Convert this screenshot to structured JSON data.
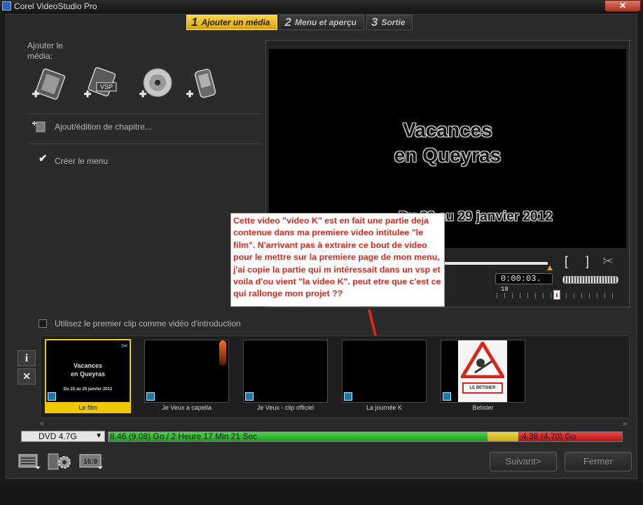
{
  "window": {
    "title": "Corel VideoStudio Pro",
    "close_label": "✕"
  },
  "steps": [
    {
      "num": "1",
      "label": "Ajouter un média"
    },
    {
      "num": "2",
      "label": "Menu et aperçu"
    },
    {
      "num": "3",
      "label": "Sortie"
    }
  ],
  "left_panel": {
    "add_media_label": "Ajouter le média:",
    "vsp_label": "VSP",
    "chapter_label": "Ajout/édition de chapitre...",
    "create_menu_label": "Créer le menu",
    "create_menu_checked": true
  },
  "preview": {
    "title_line1": "Vacances",
    "title_line2": "en Queyras",
    "date_line": "Du 22 au 29 janvier 2012",
    "timecode": "0:00:03.",
    "timecode_frames": "18",
    "bracket_in": "[",
    "bracket_out": "]"
  },
  "annotation": {
    "text": "Cette video \"video K\" est en fait une partie deja contenue dans ma premiere video intitulee \"le film\". N'arrivant pas à extraire ce bout de video pour le mettre sur la premiere page de mon menu, j'ai copie la partie qui m intéressait dans un vsp et voila d'ou vient \"la video K\". peut etre que c'est ce qui rallonge mon projet ??",
    "arrow_color": "#d9261a"
  },
  "intro_option": {
    "label": "Utilisez le premier clip comme vidéo d'introduction",
    "checked": false
  },
  "side_buttons": {
    "info": "i",
    "delete": "✕"
  },
  "clips": [
    {
      "label": "Le film",
      "selected": true,
      "t1": "Vacances",
      "t2": "en Queyras",
      "t3": "Du 22 au 29 janvier 2012"
    },
    {
      "label": "Je Veux a capella",
      "selected": false
    },
    {
      "label": "Je Veux - clip officiel",
      "selected": false
    },
    {
      "label": "La journée K",
      "selected": false
    },
    {
      "label": "Betisier",
      "selected": false,
      "sign_text": "LE BETISIER"
    }
  ],
  "disc": {
    "type": "DVD 4.7G",
    "used_text": "8.46 (9.08) Go / 2 Heure 17 Min 21 Sec",
    "remaining_text": "4.38 (4.70) Go",
    "green_fraction": 0.738,
    "yellow_fraction": 0.06
  },
  "buttons": {
    "next": "Suivant>",
    "close": "Fermer",
    "aspect_label": "16:9"
  },
  "colors": {
    "accent": "#f0c800",
    "annotation_text": "#d9261a"
  }
}
